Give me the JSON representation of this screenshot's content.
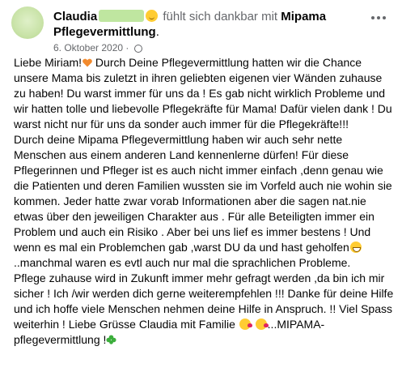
{
  "header": {
    "author": "Claudia",
    "feeling_text": "fühlt sich dankbar mit",
    "page_name_line1": "Mipama",
    "page_name_line2": "Pflegevermittlung",
    "page_name_suffix": ".",
    "date": "6. Oktober 2020",
    "separator": " · "
  },
  "post": {
    "p1_a": "Liebe Miriam!",
    "p1_b": "  Durch Deine Pflegevermittlung hatten wir die Chance unsere Mama bis zuletzt in ihren geliebten eigenen vier Wänden zuhause zu haben!  Du warst immer für uns da ! Es gab nicht wirklich Probleme und wir hatten tolle und liebevolle Pflegekräfte für Mama! Dafür vielen dank ! Du warst nicht nur für uns da sonder auch immer für die Pflegekräfte!!!",
    "p2_a": "Durch deine Mipama Pflegevermittlung haben wir auch sehr nette Menschen aus einem anderen Land kennenlerne  dürfen! Für diese Pflegerinnen und Pfleger ist es auch nicht immer einfach ,denn genau wie die Patienten und deren Familien wussten sie im Vorfeld auch nie wohin sie kommen. Jeder hatte zwar vorab Informationen aber die sagen nat.nie etwas über den jeweiligen Charakter aus .  Für alle Beteiligten immer ein Problem und auch ein Risiko . Aber bei uns lief es immer bestens ! Und wenn es mal ein Problemchen gab ,warst DU da und hast geholfen",
    "p2_b": "..manchmal waren es evtl auch nur mal die sprachlichen Probleme.",
    "p3_a": "Pflege zuhause wird in Zukunft immer mehr gefragt werden ,da bin ich mir sicher ! Ich /wir werden dich gerne weiterempfehlen !!! Danke für deine Hilfe und ich hoffe viele Menschen nehmen deine Hilfe in Anspruch.  !! Viel Spass weiterhin ! Liebe Grüsse Claudia mit Familie ",
    "p3_b": "...MIPAMA-pflegevermittlung !"
  },
  "colors": {
    "text": "#050505",
    "meta": "#65676b",
    "heart": "#f28a2d",
    "clover": "#3cae3c"
  },
  "icons": [
    "smiley-icon",
    "globe-icon",
    "more-icon",
    "orange-heart-icon",
    "grin-icon",
    "kiss-icon",
    "clover-icon"
  ]
}
